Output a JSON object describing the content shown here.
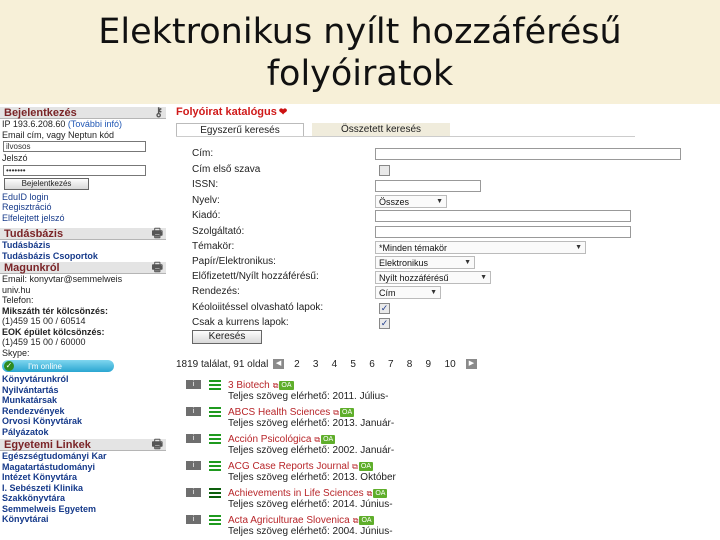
{
  "slide": {
    "title_line1": "Elektronikus nyílt hozzáférésű",
    "title_line2": "folyóiratok"
  },
  "sidebar": {
    "login": {
      "heading": "Bejelentkezés",
      "ip_label": "IP 193.6.208.60",
      "ip_more": "(További infó)",
      "email_hint": "Email cím, vagy Neptun kód",
      "username_value": "ilvosos",
      "password_label": "Jelszó",
      "password_value": "•••••••",
      "login_button": "Bejelentkezés",
      "links": [
        "EduID login",
        "Regisztráció",
        "Elfelejtett jelszó"
      ]
    },
    "knowledge": {
      "heading": "Tudásbázis",
      "items": [
        "Tudásbázis",
        "Tudásbázis Csoportok"
      ]
    },
    "about": {
      "heading": "Magunkról",
      "lines": [
        "Email: konyvtar@semmelweis",
        "univ.hu",
        "Telefon:"
      ],
      "lending_heading": "Mikszáth tér kölcsönzés:",
      "lending_phone": "(1)459 15 00 / 60514",
      "eok_heading": "EOK épület kölcsönzés:",
      "eok_phone": "(1)459 15 00 / 60000",
      "skype": "Skype:",
      "online_label": "I'm online",
      "links": [
        "Könyvtárunkról",
        "Nyilvántartás",
        "Munkatársak",
        "Rendezvények",
        "Orvosi Könyvtárak",
        "Pályázatok"
      ]
    },
    "university": {
      "heading": "Egyetemi Linkek",
      "items": [
        "Egészségtudományi Kar",
        "Magatartástudományi",
        "Intézet Könyvtára",
        "I. Sebészeti Klinika",
        "Szakkönyvtára",
        "Semmelweis Egyetem",
        "Könyvtárai"
      ]
    }
  },
  "catalog": {
    "title": "Folyóirat katalógus",
    "tabs": [
      "Egyszerű keresés",
      "Összetett keresés"
    ],
    "fields": {
      "cim": "Cím:",
      "cim_elso": "Cím első szava",
      "issn": "ISSN:",
      "nyelv": "Nyelv:",
      "kiado": "Kiadó:",
      "szolgaltato": "Szolgáltató:",
      "temakor": "Témakör:",
      "papir": "Papír/Elektronikus:",
      "elofizetett": "Előfizetett/Nyílt hozzáférésű:",
      "rendezes": "Rendezés:",
      "kapcsolt": "Kéoloiitéssel olvasható lapok:",
      "csak_kurrens": "Csak a kurrens lapok:"
    },
    "selects": {
      "nyelv": "Összes",
      "temakor": "*Minden témakör",
      "papir": "Elektronikus",
      "elofizetett": "Nyílt hozzáférésű",
      "rendezes": "Cím"
    },
    "search_button": "Keresés",
    "pager": {
      "summary": "1819 találat, 91 oldal",
      "pages": [
        "2",
        "3",
        "4",
        "5",
        "6",
        "7",
        "8",
        "9",
        "10"
      ]
    },
    "results": [
      {
        "title": "3 Biotech",
        "sub": "Teljes szöveg elérhető: 2011. Július-",
        "green_dark": false
      },
      {
        "title": "ABCS Health Sciences",
        "sub": "Teljes szöveg elérhető: 2013. Január-",
        "green_dark": false
      },
      {
        "title": "Acción Psicológica",
        "sub": "Teljes szöveg elérhető: 2002. Január-",
        "green_dark": false
      },
      {
        "title": "ACG Case Reports Journal",
        "sub": "Teljes szöveg elérhető: 2013. Október",
        "green_dark": false
      },
      {
        "title": "Achievements in Life Sciences",
        "sub": "Teljes szöveg elérhető: 2014. Június-",
        "green_dark": true
      },
      {
        "title": "Acta Agriculturae Slovenica",
        "sub": "Teljes szöveg elérhető: 2004. Június-",
        "green_dark": false
      }
    ],
    "badges": {
      "oa": "OA",
      "info": "i"
    }
  }
}
